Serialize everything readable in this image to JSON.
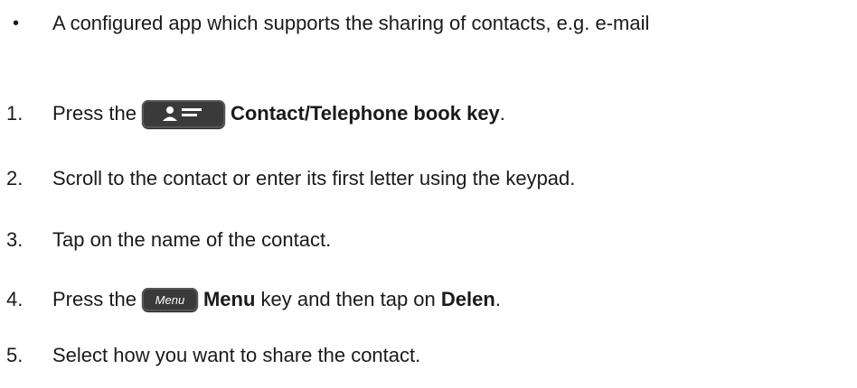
{
  "bullet": {
    "marker": "•",
    "text": "A configured app which supports the sharing of contacts, e.g. e-mail"
  },
  "steps": [
    {
      "number": "1.",
      "prefix": "Press the",
      "key_icon": "contact-book-key-icon",
      "bold": "Contact/Telephone book key",
      "suffix": "."
    },
    {
      "number": "2.",
      "text": "Scroll to the contact or enter its first letter using the keypad."
    },
    {
      "number": "3.",
      "text": "Tap on the name of the contact."
    },
    {
      "number": "4.",
      "prefix": "Press the",
      "key_label": "Menu",
      "bold": "Menu",
      "middle": "key and then tap on",
      "bold2": "Delen",
      "suffix": "."
    },
    {
      "number": "5.",
      "text": "Select how you want to share the contact."
    }
  ]
}
